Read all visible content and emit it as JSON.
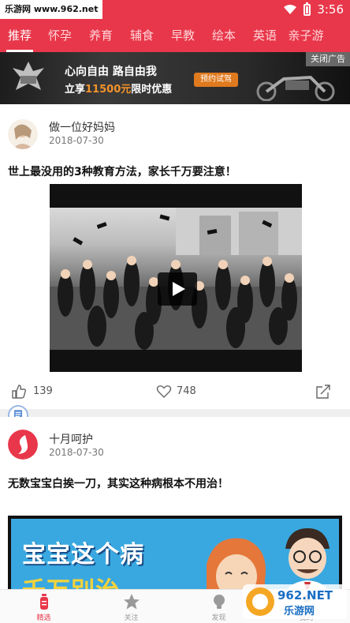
{
  "status_bar": {
    "watermark": "乐游网 www.962.net",
    "time": "3:56"
  },
  "tabs": [
    "推荐",
    "怀孕",
    "养育",
    "辅食",
    "早教",
    "绘本",
    "英语",
    "亲子游"
  ],
  "active_tab_index": 0,
  "banner": {
    "headline": "心向自由  路自由我",
    "sub_prefix": "立享",
    "sub_amount": "11500元",
    "sub_suffix": "限时优惠",
    "cta": "预约试驾",
    "close": "关闭广告"
  },
  "posts": [
    {
      "author": "做一位好妈妈",
      "date": "2018-07-30",
      "title": "世上最没用的3种教育方法，家长千万要注意！",
      "likes": "139",
      "favorites": "748"
    },
    {
      "author": "十月呵护",
      "date": "2018-07-30",
      "title": "无数宝宝白挨一刀，其实这种病根本不用治！",
      "promo_line1": "宝宝这个病",
      "promo_line2": "千万别治"
    }
  ],
  "bottom_nav": [
    "精选",
    "关注",
    "发现",
    "我的"
  ],
  "bottom_active_index": 0,
  "corner_watermark": "962.NET 乐游网",
  "colors": {
    "brand_red": "#e8374a",
    "promo_blue": "#3aa8e0",
    "banner_orange": "#e07a1e"
  }
}
